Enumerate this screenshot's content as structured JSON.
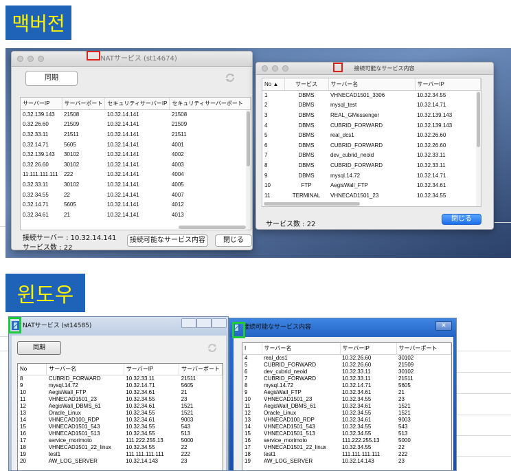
{
  "labels": {
    "mac": "맥버전",
    "windows": "윈도우"
  },
  "mac": {
    "nat": {
      "title": "NATサービス (st14674)",
      "sync_button": "同期",
      "refresh_icon": "refresh-icon",
      "columns": [
        "サーバーIP",
        "サーバーポート",
        "セキュリティサーバーIP",
        "セキュリティサーバーポート"
      ],
      "rows": [
        [
          "0.32.139.143",
          "21508",
          "10.32.14.141",
          "21508"
        ],
        [
          "0.32.26.60",
          "21509",
          "10.32.14.141",
          "21509"
        ],
        [
          "0.32.33.11",
          "21511",
          "10.32.14.141",
          "21511"
        ],
        [
          "0.32.14.71",
          "5605",
          "10.32.14.141",
          "4001"
        ],
        [
          "0.32.139.143",
          "30102",
          "10.32.14.141",
          "4002"
        ],
        [
          "0.32.26.60",
          "30102",
          "10.32.14.141",
          "4003"
        ],
        [
          "11.111.111.111",
          "222",
          "10.32.14.141",
          "4004"
        ],
        [
          "0.32.33.11",
          "30102",
          "10.32.14.141",
          "4005"
        ],
        [
          "0.32.34.55",
          "22",
          "10.32.14.141",
          "4007"
        ],
        [
          "0.32.14.71",
          "5605",
          "10.32.14.141",
          "4012"
        ],
        [
          "0.32.34.61",
          "21",
          "10.32.14.141",
          "4013"
        ]
      ],
      "server_label": "接続サーバー : 10.32.14.141",
      "count_label": "サービス数 : 22",
      "available_button": "接続可能なサービス内容",
      "close_button": "閉じる"
    },
    "avail": {
      "title": "接続可能なサービス内容",
      "columns": [
        "No ▲",
        "サービス",
        "サーバー名",
        "サーバーIP"
      ],
      "rows": [
        [
          "1",
          "DBMS",
          "VHNECAD1501_3306",
          "10.32.34.55"
        ],
        [
          "2",
          "DBMS",
          "mysql_test",
          "10.32.14.71"
        ],
        [
          "3",
          "DBMS",
          "REAL_GMessenger",
          "10.32.139.143"
        ],
        [
          "4",
          "DBMS",
          "CUBRID_FORWARD",
          "10.32.139.143"
        ],
        [
          "5",
          "DBMS",
          "real_dcs1",
          "10.32.26.60"
        ],
        [
          "6",
          "DBMS",
          "CUBRID_FORWARD",
          "10.32.26.60"
        ],
        [
          "7",
          "DBMS",
          "dev_cubrid_neoid",
          "10.32.33.11"
        ],
        [
          "8",
          "DBMS",
          "CUBRID_FORWARD",
          "10.32.33.11"
        ],
        [
          "9",
          "DBMS",
          "mysql.14.72",
          "10.32.14.71"
        ],
        [
          "10",
          "FTP",
          "AegisWall_FTP",
          "10.32.34.61"
        ],
        [
          "11",
          "TERMINAL",
          "VHNECAD1501_23",
          "10.32.34.55"
        ]
      ],
      "count_label": "サービス数 : 22",
      "close_button": "閉じる"
    }
  },
  "win": {
    "nat": {
      "title": "NATサービス (st14585)",
      "sync_button": "同期",
      "columns": [
        "No",
        "サーバー名",
        "サーバーIP",
        "サーバーポート"
      ],
      "rows": [
        [
          "8",
          "CUBRID_FORWARD",
          "10.32.33.11",
          "21511"
        ],
        [
          "9",
          "mysql.14.72",
          "10.32.14.71",
          "5605"
        ],
        [
          "10",
          "AegisWall_FTP",
          "10.32.34.61",
          "21"
        ],
        [
          "11",
          "VHNECAD1501_23",
          "10.32.34.55",
          "23"
        ],
        [
          "12",
          "AegisWall_DBMS_61",
          "10.32.34.61",
          "1521"
        ],
        [
          "13",
          "Oracle_Linux",
          "10.32.34.55",
          "1521"
        ],
        [
          "14",
          "VHNECAD100_RDP",
          "10.32.34.61",
          "9003"
        ],
        [
          "15",
          "VHNECAD1501_543",
          "10.32.34.55",
          "543"
        ],
        [
          "16",
          "VHNECAD1501_513",
          "10.32.34.55",
          "513"
        ],
        [
          "17",
          "service_morimoto",
          "111.222.255.13",
          "5000"
        ],
        [
          "18",
          "VHNECAD1501_22_linux",
          "10.32.34.55",
          "22"
        ],
        [
          "19",
          "test1",
          "111.111.111.111",
          "222"
        ],
        [
          "20",
          "AW_LOG_SERVER",
          "10.32.14.143",
          "23"
        ]
      ]
    },
    "avail": {
      "title": "接続可能なサービス内容",
      "columns": [
        "I",
        "サーバー名",
        "サーバーIP",
        "サーバーポート"
      ],
      "rows": [
        [
          "4",
          "real_dcs1",
          "10.32.26.60",
          "30102"
        ],
        [
          "5",
          "CUBRID_FORWARD",
          "10.32.26.60",
          "21509"
        ],
        [
          "6",
          "dev_cubrid_neoid",
          "10.32.33.11",
          "30102"
        ],
        [
          "7",
          "CUBRID_FORWARD",
          "10.32.33.11",
          "21511"
        ],
        [
          "8",
          "mysql.14.72",
          "10.32.14.71",
          "5605"
        ],
        [
          "9",
          "AegisWall_FTP",
          "10.32.34.61",
          "21"
        ],
        [
          "10",
          "VHNECAD1501_23",
          "10.32.34.55",
          "23"
        ],
        [
          "11",
          "AegisWall_DBMS_61",
          "10.32.34.61",
          "1521"
        ],
        [
          "12",
          "Oracle_Linux",
          "10.32.34.55",
          "1521"
        ],
        [
          "13",
          "VHNECAD100_RDP",
          "10.32.34.61",
          "9003"
        ],
        [
          "14",
          "VHNECAD1501_543",
          "10.32.34.55",
          "543"
        ],
        [
          "15",
          "VHNECAD1501_513",
          "10.32.34.55",
          "513"
        ],
        [
          "16",
          "service_morimoto",
          "111.222.255.13",
          "5000"
        ],
        [
          "17",
          "VHNECAD1501_22_linux",
          "10.32.34.55",
          "22"
        ],
        [
          "18",
          "test1",
          "111.111.111.111",
          "222"
        ],
        [
          "19",
          "AW_LOG_SERVER",
          "10.32.14.143",
          "23"
        ]
      ]
    }
  }
}
